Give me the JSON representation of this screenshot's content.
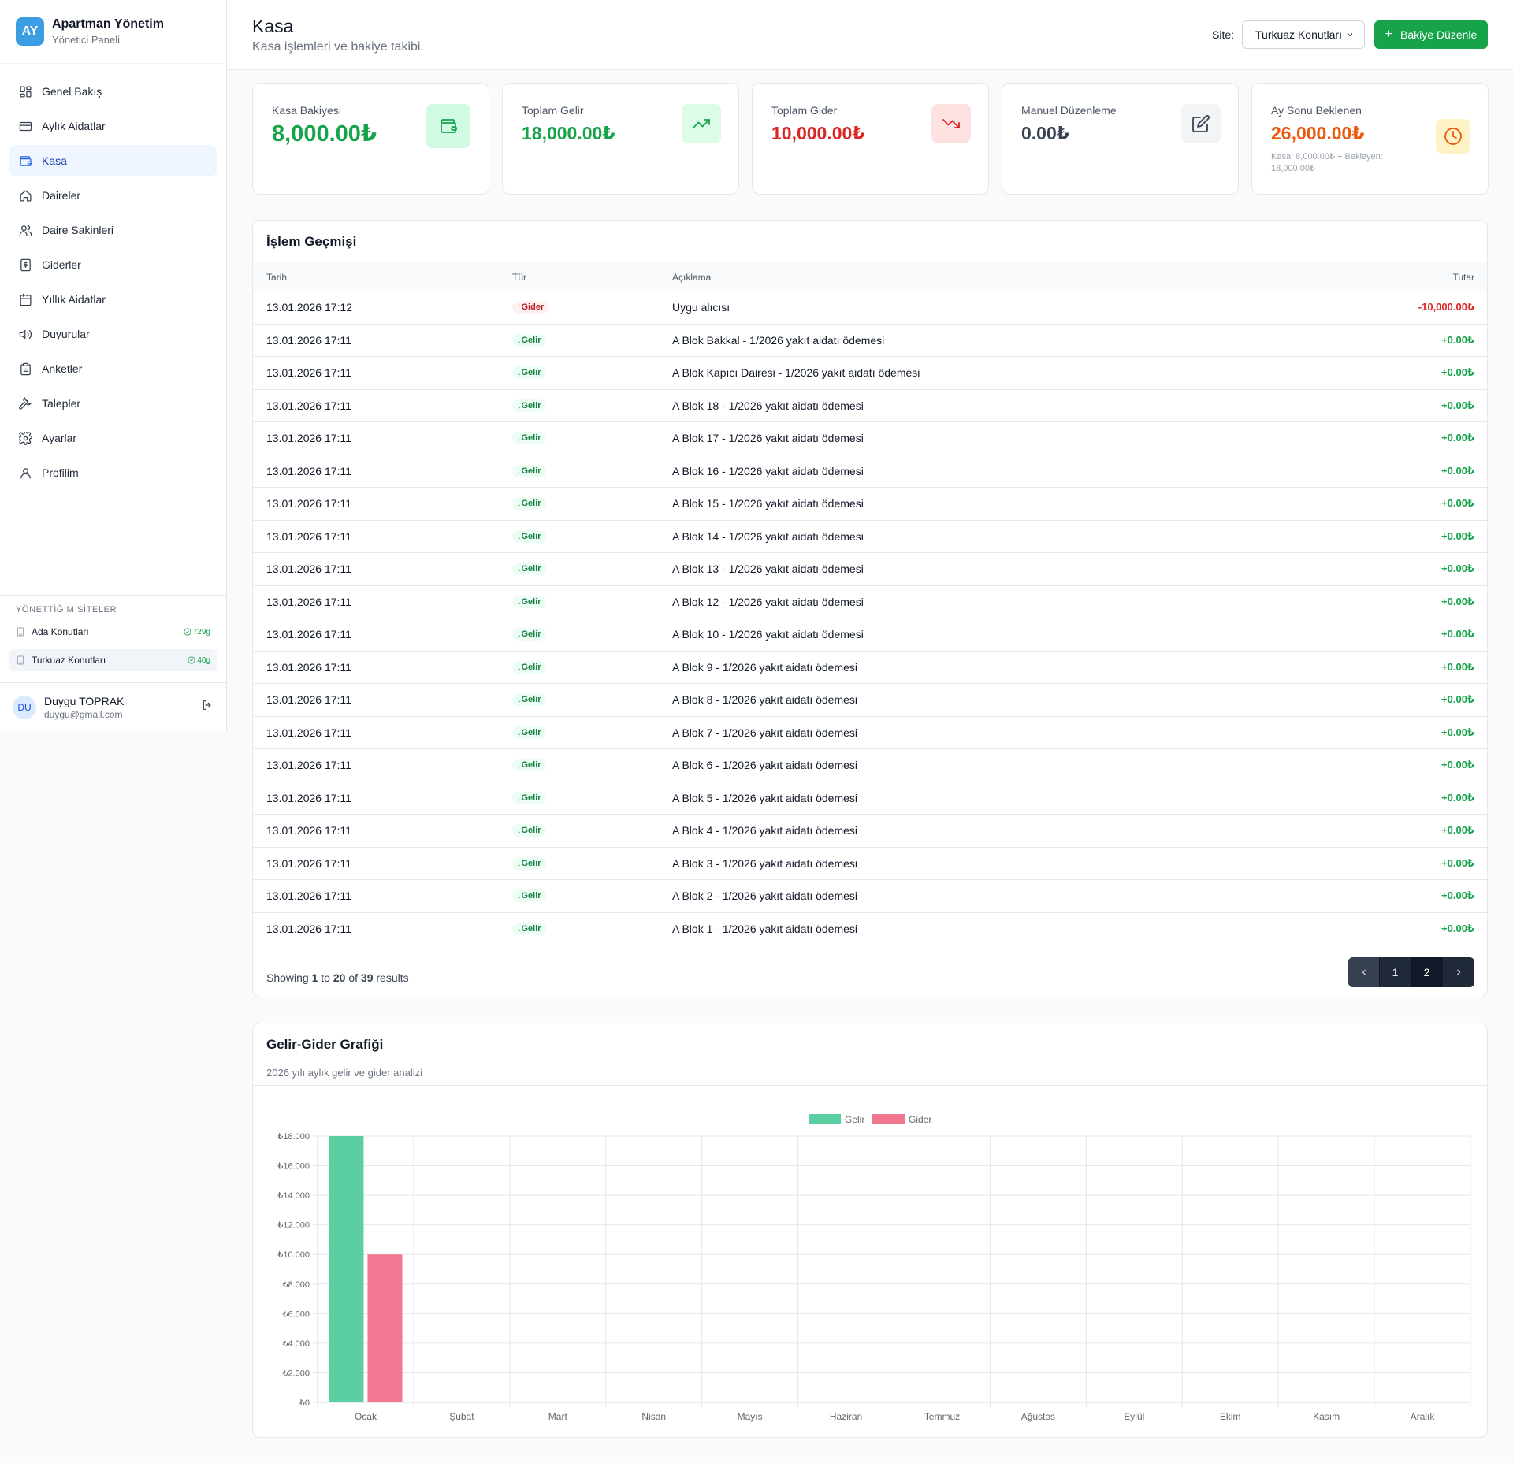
{
  "brand": {
    "logo": "AY",
    "title": "Apartman Yönetim",
    "subtitle": "Yönetici Paneli"
  },
  "nav": [
    {
      "label": "Genel Bakış",
      "icon": "dashboard-icon",
      "active": false
    },
    {
      "label": "Aylık Aidatlar",
      "icon": "credit-card-icon",
      "active": false
    },
    {
      "label": "Kasa",
      "icon": "wallet-icon",
      "active": true
    },
    {
      "label": "Daireler",
      "icon": "home-icon",
      "active": false
    },
    {
      "label": "Daire Sakinleri",
      "icon": "users-icon",
      "active": false
    },
    {
      "label": "Giderler",
      "icon": "receipt-icon",
      "active": false
    },
    {
      "label": "Yıllık Aidatlar",
      "icon": "calendar-icon",
      "active": false
    },
    {
      "label": "Duyurular",
      "icon": "megaphone-icon",
      "active": false
    },
    {
      "label": "Anketler",
      "icon": "clipboard-icon",
      "active": false
    },
    {
      "label": "Talepler",
      "icon": "wrench-icon",
      "active": false
    },
    {
      "label": "Ayarlar",
      "icon": "gear-icon",
      "active": false
    },
    {
      "label": "Profilim",
      "icon": "user-icon",
      "active": false
    }
  ],
  "sites": {
    "title": "YÖNETTİĞİM SİTELER",
    "items": [
      {
        "name": "Ada Konutları",
        "badge": "729g",
        "active": false
      },
      {
        "name": "Turkuaz Konutları",
        "badge": "40g",
        "active": true
      }
    ]
  },
  "user": {
    "initials": "DU",
    "name": "Duygu TOPRAK",
    "email": "duygu@gmail.com"
  },
  "header": {
    "title": "Kasa",
    "subtitle": "Kasa işlemleri ve bakiye takibi.",
    "site_label": "Site:",
    "site_value": "Turkuaz Konutları",
    "edit_button": "Bakiye Düzenle"
  },
  "cards": [
    {
      "label": "Kasa Bakiyesi",
      "value": "8,000.00₺",
      "color": "#16a34a",
      "icon_bg": "#d1fae5",
      "icon": "wallet-icon",
      "note": ""
    },
    {
      "label": "Toplam Gelir",
      "value": "18,000.00₺",
      "color": "#16a34a",
      "icon_bg": "#dcfce7",
      "icon": "trending-up-icon",
      "note": ""
    },
    {
      "label": "Toplam Gider",
      "value": "10,000.00₺",
      "color": "#dc2626",
      "icon_bg": "#fee2e2",
      "icon": "trending-down-icon",
      "note": ""
    },
    {
      "label": "Manuel Düzenleme",
      "value": "0.00₺",
      "color": "#374151",
      "icon_bg": "#f3f4f6",
      "icon": "edit-icon",
      "note": ""
    },
    {
      "label": "Ay Sonu Beklenen",
      "value": "26,000.00₺",
      "color": "#ea580c",
      "icon_bg": "#fef3c7",
      "icon": "clock-icon",
      "note": "Kasa: 8,000.00₺ + Bekleyen: 18,000.00₺"
    }
  ],
  "transactions": {
    "title": "İşlem Geçmişi",
    "columns": {
      "date": "Tarih",
      "type": "Tür",
      "desc": "Açıklama",
      "amount": "Tutar"
    },
    "rows": [
      {
        "date": "13.01.2026 17:12",
        "type": "Gider",
        "kind": "out",
        "desc": "Uygu alıcısı",
        "amount": "-10,000.00₺"
      },
      {
        "date": "13.01.2026 17:11",
        "type": "Gelir",
        "kind": "in",
        "desc": "A Blok Bakkal - 1/2026 yakıt aidatı ödemesi",
        "amount": "+0.00₺"
      },
      {
        "date": "13.01.2026 17:11",
        "type": "Gelir",
        "kind": "in",
        "desc": "A Blok Kapıcı Dairesi - 1/2026 yakıt aidatı ödemesi",
        "amount": "+0.00₺"
      },
      {
        "date": "13.01.2026 17:11",
        "type": "Gelir",
        "kind": "in",
        "desc": "A Blok 18 - 1/2026 yakıt aidatı ödemesi",
        "amount": "+0.00₺"
      },
      {
        "date": "13.01.2026 17:11",
        "type": "Gelir",
        "kind": "in",
        "desc": "A Blok 17 - 1/2026 yakıt aidatı ödemesi",
        "amount": "+0.00₺"
      },
      {
        "date": "13.01.2026 17:11",
        "type": "Gelir",
        "kind": "in",
        "desc": "A Blok 16 - 1/2026 yakıt aidatı ödemesi",
        "amount": "+0.00₺"
      },
      {
        "date": "13.01.2026 17:11",
        "type": "Gelir",
        "kind": "in",
        "desc": "A Blok 15 - 1/2026 yakıt aidatı ödemesi",
        "amount": "+0.00₺"
      },
      {
        "date": "13.01.2026 17:11",
        "type": "Gelir",
        "kind": "in",
        "desc": "A Blok 14 - 1/2026 yakıt aidatı ödemesi",
        "amount": "+0.00₺"
      },
      {
        "date": "13.01.2026 17:11",
        "type": "Gelir",
        "kind": "in",
        "desc": "A Blok 13 - 1/2026 yakıt aidatı ödemesi",
        "amount": "+0.00₺"
      },
      {
        "date": "13.01.2026 17:11",
        "type": "Gelir",
        "kind": "in",
        "desc": "A Blok 12 - 1/2026 yakıt aidatı ödemesi",
        "amount": "+0.00₺"
      },
      {
        "date": "13.01.2026 17:11",
        "type": "Gelir",
        "kind": "in",
        "desc": "A Blok 10 - 1/2026 yakıt aidatı ödemesi",
        "amount": "+0.00₺"
      },
      {
        "date": "13.01.2026 17:11",
        "type": "Gelir",
        "kind": "in",
        "desc": "A Blok 9 - 1/2026 yakıt aidatı ödemesi",
        "amount": "+0.00₺"
      },
      {
        "date": "13.01.2026 17:11",
        "type": "Gelir",
        "kind": "in",
        "desc": "A Blok 8 - 1/2026 yakıt aidatı ödemesi",
        "amount": "+0.00₺"
      },
      {
        "date": "13.01.2026 17:11",
        "type": "Gelir",
        "kind": "in",
        "desc": "A Blok 7 - 1/2026 yakıt aidatı ödemesi",
        "amount": "+0.00₺"
      },
      {
        "date": "13.01.2026 17:11",
        "type": "Gelir",
        "kind": "in",
        "desc": "A Blok 6 - 1/2026 yakıt aidatı ödemesi",
        "amount": "+0.00₺"
      },
      {
        "date": "13.01.2026 17:11",
        "type": "Gelir",
        "kind": "in",
        "desc": "A Blok 5 - 1/2026 yakıt aidatı ödemesi",
        "amount": "+0.00₺"
      },
      {
        "date": "13.01.2026 17:11",
        "type": "Gelir",
        "kind": "in",
        "desc": "A Blok 4 - 1/2026 yakıt aidatı ödemesi",
        "amount": "+0.00₺"
      },
      {
        "date": "13.01.2026 17:11",
        "type": "Gelir",
        "kind": "in",
        "desc": "A Blok 3 - 1/2026 yakıt aidatı ödemesi",
        "amount": "+0.00₺"
      },
      {
        "date": "13.01.2026 17:11",
        "type": "Gelir",
        "kind": "in",
        "desc": "A Blok 2 - 1/2026 yakıt aidatı ödemesi",
        "amount": "+0.00₺"
      },
      {
        "date": "13.01.2026 17:11",
        "type": "Gelir",
        "kind": "in",
        "desc": "A Blok 1 - 1/2026 yakıt aidatı ödemesi",
        "amount": "+0.00₺"
      }
    ],
    "footer": {
      "prefix": "Showing",
      "from": "1",
      "to_word": "to",
      "to": "20",
      "of_word": "of",
      "total": "39",
      "suffix": "results"
    },
    "pages": [
      "1",
      "2"
    ],
    "current_page": "2"
  },
  "chart_panel": {
    "title": "Gelir-Gider Grafiği",
    "subtitle": "2026 yılı aylık gelir ve gider analizi"
  },
  "chart_data": {
    "type": "bar",
    "categories": [
      "Ocak",
      "Şubat",
      "Mart",
      "Nisan",
      "Mayıs",
      "Haziran",
      "Temmuz",
      "Ağustos",
      "Eylül",
      "Ekim",
      "Kasım",
      "Aralık"
    ],
    "series": [
      {
        "name": "Gelir",
        "color": "#5ccfa2",
        "values": [
          18000,
          0,
          0,
          0,
          0,
          0,
          0,
          0,
          0,
          0,
          0,
          0
        ]
      },
      {
        "name": "Gider",
        "color": "#f27790",
        "values": [
          10000,
          0,
          0,
          0,
          0,
          0,
          0,
          0,
          0,
          0,
          0,
          0
        ]
      }
    ],
    "ylim": [
      0,
      18000
    ],
    "yticks": [
      0,
      2000,
      4000,
      6000,
      8000,
      10000,
      12000,
      14000,
      16000,
      18000
    ],
    "ytick_labels": [
      "₺0",
      "₺2.000",
      "₺4.000",
      "₺6.000",
      "₺8.000",
      "₺10.000",
      "₺12.000",
      "₺14.000",
      "₺16.000",
      "₺18.000"
    ],
    "legend": "top-center",
    "grid": true
  }
}
